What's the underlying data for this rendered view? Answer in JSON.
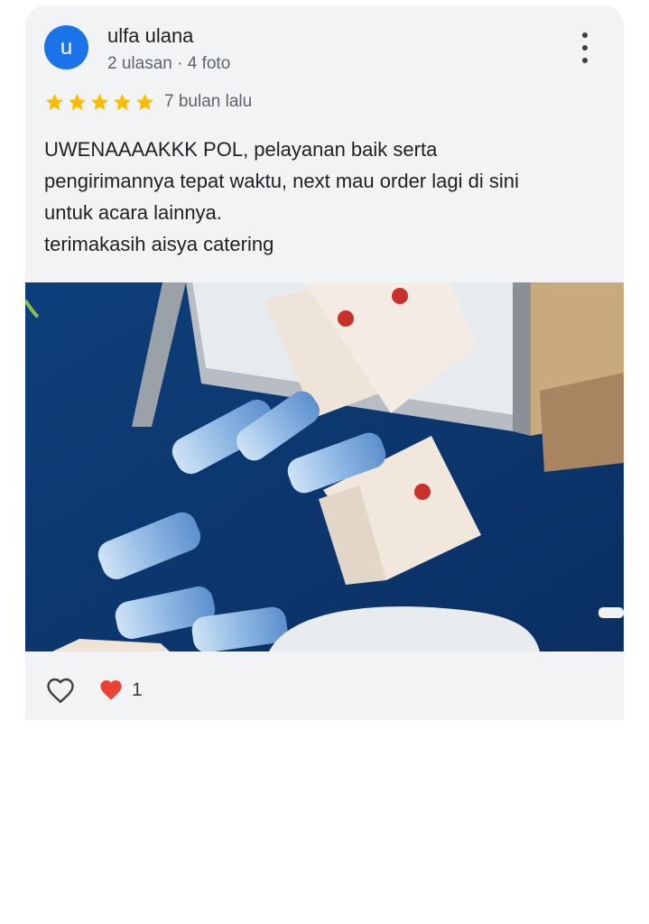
{
  "review": {
    "author_initial": "u",
    "author_name": "ulfa ulana",
    "author_meta": "2 ulasan · 4 foto",
    "rating": 5,
    "time_ago": "7 bulan lalu",
    "text_lines": [
      "UWENAAAAKKK POL, pelayanan baik serta",
      "pengirimannya tepat waktu, next mau order lagi di sini",
      "untuk acara lainnya.",
      "terimakasih aisya catering"
    ],
    "reaction_count": "1"
  },
  "colors": {
    "avatar": "#1a73e8",
    "star": "#fbbc04",
    "card_bg": "#f1f3f4",
    "heart_red": "#ea4335"
  },
  "icons": {
    "more": "more-vert-icon",
    "star": "star-icon",
    "like": "heart-outline-icon",
    "reaction": "heart-filled-icon"
  }
}
